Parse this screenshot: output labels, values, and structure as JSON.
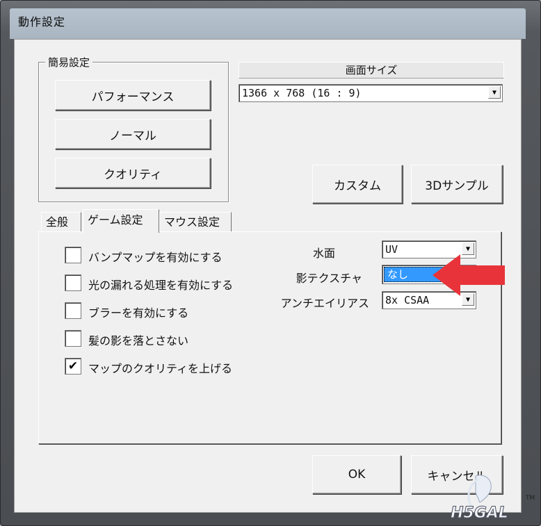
{
  "window": {
    "title": "動作設定"
  },
  "easy_settings": {
    "legend": "簡易設定",
    "buttons": [
      "パフォーマンス",
      "ノーマル",
      "クオリティ"
    ]
  },
  "screen_size": {
    "label": "画面サイズ",
    "value": "1366 x 768 (16 : 9)"
  },
  "preset_buttons": {
    "custom": "カスタム",
    "sample3d": "3Dサンプル"
  },
  "tabs": [
    {
      "label": "全般",
      "active": false
    },
    {
      "label": "ゲーム設定",
      "active": true
    },
    {
      "label": "マウス設定",
      "active": false
    }
  ],
  "checkboxes": [
    {
      "label": "バンプマップを有効にする",
      "checked": false,
      "mark": ""
    },
    {
      "label": "光の漏れる処理を有効にする",
      "checked": false,
      "mark": ""
    },
    {
      "label": "ブラーを有効にする",
      "checked": false,
      "mark": ""
    },
    {
      "label": "髪の影を落とさない",
      "checked": false,
      "mark": ""
    },
    {
      "label": "マップのクオリティを上げる",
      "checked": true,
      "mark": "✔"
    }
  ],
  "options": {
    "water": {
      "label": "水面",
      "value": "UV"
    },
    "shadow": {
      "label": "影テクスチャ",
      "value": "なし"
    },
    "aa": {
      "label": "アンチエイリアス",
      "value": "8x CSAA"
    }
  },
  "footer": {
    "ok": "OK",
    "cancel": "キャンセル"
  },
  "watermark": {
    "text": "H5GAL",
    "tm": "TM"
  },
  "colors": {
    "highlight": "#3399ff",
    "arrow": "#e8333a",
    "face": "#f0f0f0"
  },
  "icons": {
    "dropdown": "▼",
    "check": "✔"
  }
}
